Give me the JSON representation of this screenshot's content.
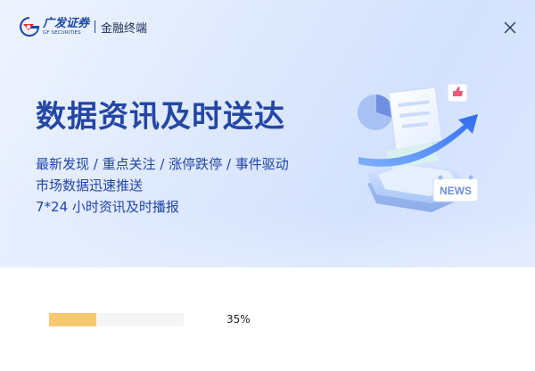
{
  "app": {
    "brand_cn": "广发证券",
    "brand_en": "GF SECURITIES",
    "product": "金融终端"
  },
  "banner": {
    "headline": "数据资讯及时送达",
    "lines": [
      "最新发现 / 重点关注 / 涨停跌停 / 事件驱动",
      "市场数据迅速推送",
      "7*24 小时资讯及时播报"
    ],
    "badge_text": "NEWS"
  },
  "progress": {
    "percent": 35,
    "label": "35%"
  },
  "icons": {
    "close": "close-icon",
    "logo": "gf-logo-icon",
    "illustration": "news-illustration"
  },
  "colors": {
    "brand_blue": "#1c47a6",
    "headline": "#2446a5",
    "progress_fill": "#f6c871",
    "logo_red": "#e42424"
  }
}
